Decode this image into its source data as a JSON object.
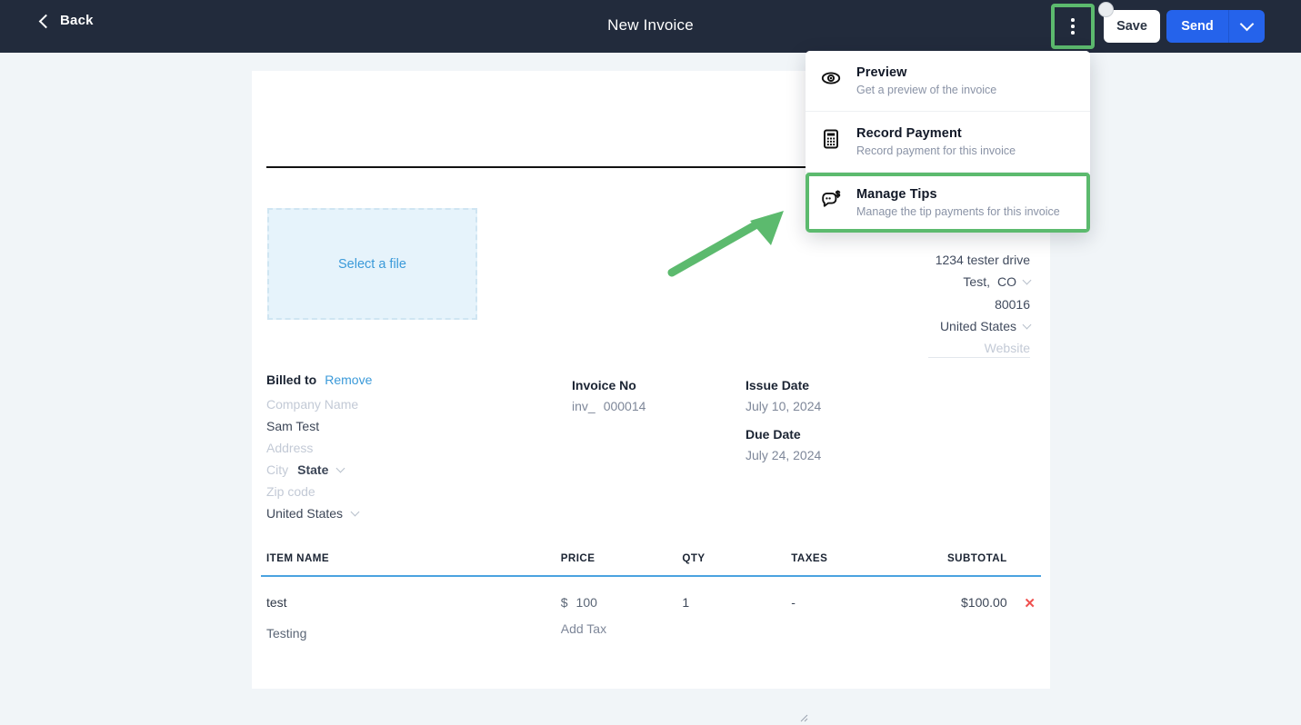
{
  "topbar": {
    "back_label": "Back",
    "title": "New Invoice",
    "save_label": "Save",
    "send_label": "Send",
    "kebab_icon": "kebab-menu-icon",
    "caret_icon": "chevron-down-icon",
    "bg_color": "#222b3c",
    "accent_color": "#2563eb"
  },
  "highlight": {
    "color": "#5cba6e"
  },
  "menu": {
    "items": [
      {
        "title": "Preview",
        "subtitle": "Get a preview of the invoice",
        "icon": "eye-icon",
        "highlighted": false
      },
      {
        "title": "Record Payment",
        "subtitle": "Record payment for this invoice",
        "icon": "calculator-icon",
        "highlighted": false
      },
      {
        "title": "Manage Tips",
        "subtitle": "Manage the tip payments for this invoice",
        "icon": "chat-dollar-icon",
        "highlighted": true
      }
    ]
  },
  "invoice": {
    "dropzone_label": "Select a file",
    "sender_address": {
      "street": "1234 tester drive",
      "city": "Test,",
      "state": "CO",
      "zip": "80016",
      "country": "United States",
      "website_placeholder": "Website"
    },
    "billed_to": {
      "label": "Billed to",
      "remove_label": "Remove",
      "company_placeholder": "Company Name",
      "name": "Sam Test",
      "address_placeholder": "Address",
      "city_placeholder": "City",
      "state_value": "State",
      "zip_placeholder": "Zip code",
      "country": "United States"
    },
    "invoice_no": {
      "label": "Invoice No",
      "prefix": "inv_",
      "number": "000014"
    },
    "issue_date": {
      "label": "Issue Date",
      "value": "July 10, 2024"
    },
    "due_date": {
      "label": "Due Date",
      "value": "July 24, 2024"
    },
    "table": {
      "headers": {
        "name": "ITEM NAME",
        "price": "PRICE",
        "qty": "QTY",
        "taxes": "TAXES",
        "subtotal": "SUBTOTAL"
      },
      "rows": [
        {
          "name": "test",
          "description": "Testing",
          "currency": "$",
          "price": "100",
          "add_tax_label": "Add Tax",
          "qty": "1",
          "taxes": "-",
          "subtotal": "$100.00",
          "remove_icon": "close-x-icon"
        }
      ]
    }
  }
}
